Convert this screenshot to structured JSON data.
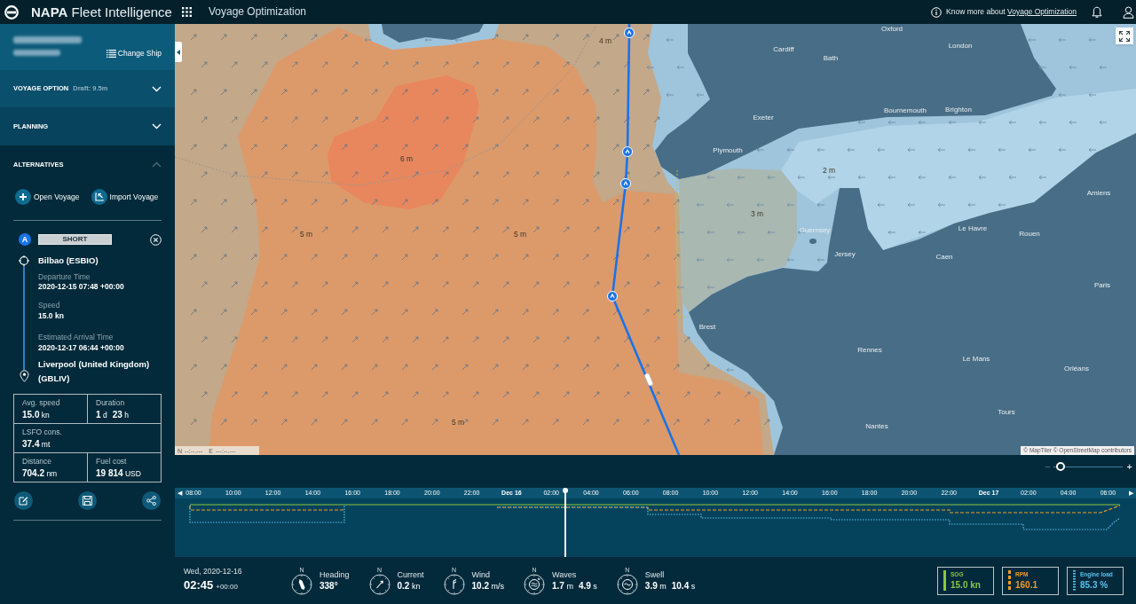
{
  "app_bar": {
    "title": "**NAPA** Fleet Intelligence",
    "module": "Voyage Optimization",
    "help_text": "Know more about",
    "help_link": "Voyage Optimization"
  },
  "sidebar": {
    "ship": {
      "change_button": "Change Ship"
    },
    "sections": [
      {
        "title": "VOYAGE OPTION",
        "note": "Draft: 9.5m",
        "expanded": false
      },
      {
        "title": "PLANNING",
        "expanded": false
      },
      {
        "title": "ALTERNATIVES",
        "expanded": true
      }
    ],
    "actions": [
      {
        "kind": "open",
        "label": "Open Voyage"
      },
      {
        "kind": "import",
        "label": "Import Voyage"
      }
    ],
    "alternative": {
      "badge": "A",
      "name": "SHORT",
      "origin": "Bilbao (ESBIO)",
      "fields": [
        {
          "label": "Departure Time",
          "value": "2020-12-15 07:48 +00:00"
        },
        {
          "label": "Speed",
          "value": "15.0 kn"
        },
        {
          "label": "Estimated Arrival Time",
          "value": "2020-12-17 06:44 +00:00"
        }
      ],
      "destination": "Liverpool (United Kingdom) (GBLIV)",
      "stat_rows": [
        {
          "cells": [
            {
              "label": "Avg. speed",
              "readings": [
                {
                  "value": "15.0",
                  "unit": "kn"
                }
              ]
            },
            {
              "label": "Duration",
              "readings": [
                {
                  "value": "1",
                  "unit": "d"
                },
                {
                  "value": "23",
                  "unit": "h"
                }
              ]
            }
          ]
        },
        {
          "cells": [
            {
              "label": "LSFO cons.",
              "readings": [
                {
                  "value": "37.4",
                  "unit": "mt"
                }
              ]
            }
          ]
        },
        {
          "cells": [
            {
              "label": "Distance",
              "readings": [
                {
                  "value": "704.2",
                  "unit": "nm"
                }
              ]
            },
            {
              "label": "Fuel cost",
              "readings": [
                {
                  "value": "19 814",
                  "unit": "USD"
                }
              ]
            }
          ]
        }
      ]
    }
  },
  "map": {
    "wave_labels": [
      "4 m",
      "6 m",
      "5 m",
      "5 m",
      "5 m",
      "3 m",
      "2 m"
    ],
    "places": [
      "Oxford",
      "London",
      "Cardiff",
      "Bath",
      "Exeter",
      "Plymouth",
      "Bournemouth",
      "Brighton",
      "Guernsey",
      "Jersey",
      "Le Havre",
      "Rouen",
      "Amiens",
      "Caen",
      "Paris",
      "Brest",
      "Rennes",
      "Le Mans",
      "Orléans",
      "Nantes",
      "Tours"
    ],
    "coordinates": [
      {
        "axis": "N",
        "value": "--:--.---"
      },
      {
        "axis": "E",
        "value": "---:--.---"
      }
    ],
    "attribution": "© MapTiler © OpenStreetMap contributors"
  },
  "timeline": {
    "zoom": {
      "minus": "−",
      "plus": "+",
      "level": 0.05
    },
    "prev": "◀",
    "next": "▶",
    "ticks": [
      {
        "label": "08:00",
        "kind": "time"
      },
      {
        "label": "10:00",
        "kind": "time"
      },
      {
        "label": "12:00",
        "kind": "time"
      },
      {
        "label": "14:00",
        "kind": "time"
      },
      {
        "label": "16:00",
        "kind": "time"
      },
      {
        "label": "18:00",
        "kind": "time"
      },
      {
        "label": "20:00",
        "kind": "time"
      },
      {
        "label": "22:00",
        "kind": "time"
      },
      {
        "label": "Dec 16",
        "kind": "date"
      },
      {
        "label": "02:00",
        "kind": "time"
      },
      {
        "label": "04:00",
        "kind": "time"
      },
      {
        "label": "06:00",
        "kind": "time"
      },
      {
        "label": "08:00",
        "kind": "time"
      },
      {
        "label": "10:00",
        "kind": "time"
      },
      {
        "label": "12:00",
        "kind": "time"
      },
      {
        "label": "14:00",
        "kind": "time"
      },
      {
        "label": "16:00",
        "kind": "time"
      },
      {
        "label": "18:00",
        "kind": "time"
      },
      {
        "label": "20:00",
        "kind": "time"
      },
      {
        "label": "22:00",
        "kind": "time"
      },
      {
        "label": "Dec 17",
        "kind": "date"
      },
      {
        "label": "02:00",
        "kind": "time"
      },
      {
        "label": "04:00",
        "kind": "time"
      },
      {
        "label": "06:00",
        "kind": "time"
      }
    ]
  },
  "status_bar": {
    "date": "Wed, 2020-12-16",
    "time": "02:45",
    "zone": "+00:00",
    "conditions": [
      {
        "kind": "heading",
        "north": "N",
        "label": "Heading",
        "readings": [
          {
            "value": "338°"
          }
        ]
      },
      {
        "kind": "current",
        "north": "N",
        "label": "Current",
        "readings": [
          {
            "value": "0.2",
            "unit": "kn"
          }
        ]
      },
      {
        "kind": "wind",
        "north": "N",
        "label": "Wind",
        "readings": [
          {
            "value": "10.2",
            "unit": "m/s"
          }
        ]
      },
      {
        "kind": "waves",
        "north": "N",
        "label": "Waves",
        "readings": [
          {
            "value": "1.7",
            "unit": "m"
          },
          {
            "value": "4.9",
            "unit": "s"
          }
        ]
      },
      {
        "kind": "swell",
        "north": "N",
        "label": "Swell",
        "readings": [
          {
            "value": "3.9",
            "unit": "m"
          },
          {
            "value": "10.4",
            "unit": "s"
          }
        ]
      }
    ],
    "metrics": [
      {
        "label": "SOG",
        "value": "15.0 kn",
        "color": "#8dc63f",
        "kind": "solid"
      },
      {
        "label": "RPM",
        "value": "160.1",
        "color": "#f39c1f",
        "kind": "dashed"
      },
      {
        "label": "Engine load",
        "value": "85.3 %",
        "color": "#5bc0eb",
        "kind": "dotted"
      }
    ]
  }
}
